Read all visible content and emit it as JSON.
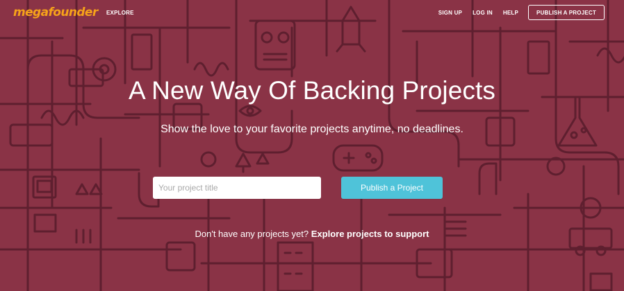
{
  "header": {
    "logo_text": "megafounder",
    "explore_label": "EXPLORE",
    "signup_label": "SIGN UP",
    "login_label": "LOG IN",
    "help_label": "HELP",
    "publish_label": "PUBLISH A PROJECT"
  },
  "hero": {
    "title": "A New Way Of Backing Projects",
    "subtitle": "Show the love to your favorite projects anytime, no deadlines.",
    "input_placeholder": "Your project title",
    "publish_button": "Publish a Project",
    "cta_prefix": "Don't have any projects yet?",
    "cta_link": "Explore projects to support"
  },
  "colors": {
    "background": "#8a3346",
    "line_art": "#5e1f2f",
    "logo": "#f6a21a",
    "accent_button": "#4fc3d9"
  },
  "icons": [
    "robot-icon",
    "rocket-icon",
    "gamepad-icon",
    "eye-icon",
    "flask-icon",
    "tree-icon",
    "hand-icon",
    "truck-icon"
  ]
}
